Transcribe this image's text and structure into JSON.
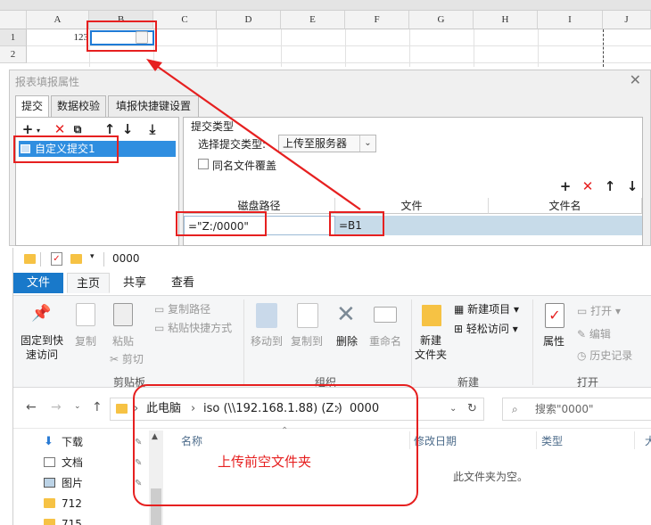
{
  "spreadsheet": {
    "columns": [
      "A",
      "B",
      "C",
      "D",
      "E",
      "F",
      "G",
      "H",
      "I",
      "J"
    ],
    "rows": [
      "1",
      "2"
    ],
    "cell_a1": "123"
  },
  "dialog": {
    "title": "报表填报属性",
    "tabs": [
      "提交",
      "数据校验",
      "填报快捷键设置"
    ],
    "list_items": [
      "自定义提交1"
    ],
    "group_label": "提交类型",
    "submit_type_label": "选择提交类型:",
    "submit_type_value": "上传至服务器",
    "overwrite_label": "同名文件覆盖",
    "table_headers": [
      "磁盘路径",
      "文件",
      "文件名"
    ],
    "row": {
      "path": "=\"Z:/0000\"",
      "file": "=B1",
      "filename": ""
    }
  },
  "explorer": {
    "title": "0000",
    "ribbon_tabs": [
      "文件",
      "主页",
      "共享",
      "查看"
    ],
    "groups": [
      "剪贴板",
      "组织",
      "新建",
      "打开"
    ],
    "clipboard": {
      "pin": [
        "固定到快",
        "速访问"
      ],
      "copy": "复制",
      "paste": "粘贴",
      "copy_path": "复制路径",
      "paste_shortcut": "粘贴快捷方式",
      "cut": "剪切"
    },
    "organize": {
      "move_to": "移动到",
      "copy_to": "复制到",
      "delete": "删除",
      "rename": "重命名"
    },
    "new": {
      "new_folder": [
        "新建",
        "文件夹"
      ],
      "new_item": "新建项目",
      "easy_access": "轻松访问"
    },
    "open": {
      "properties": "属性",
      "open": "打开",
      "edit": "编辑",
      "history": "历史记录"
    },
    "address": [
      "此电脑",
      "iso (\\\\192.168.1.88) (Z:)",
      "0000"
    ],
    "search_placeholder": "搜索\"0000\"",
    "sidebar": [
      "下载",
      "文档",
      "图片",
      "712",
      "715"
    ],
    "columns": [
      "名称",
      "修改日期",
      "类型",
      "大"
    ],
    "empty_message": "此文件夹为空。"
  },
  "annotation": "上传前空文件夹",
  "colors": {
    "accent": "#1979ca",
    "annotation_red": "#e62020",
    "selection": "#2f8ee0"
  }
}
